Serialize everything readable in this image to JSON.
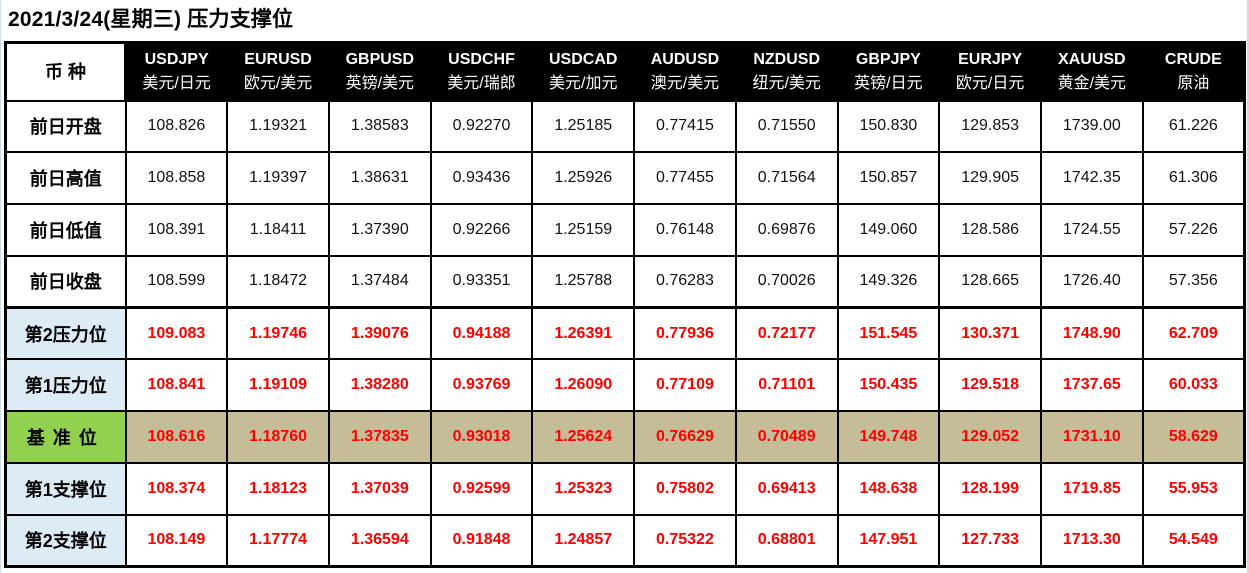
{
  "title": "2021/3/24(星期三) 压力支撑位",
  "corner_label": "币 种",
  "colors": {
    "header_bg": "#000000",
    "header_text": "#ffffff",
    "level_text": "#ff0000",
    "level_label_bg": "#ddebf5",
    "pivot_label_bg": "#92d050",
    "pivot_row_bg": "#c4bd97"
  },
  "columns": [
    {
      "code": "USDJPY",
      "name": "美元/日元"
    },
    {
      "code": "EURUSD",
      "name": "欧元/美元"
    },
    {
      "code": "GBPUSD",
      "name": "英镑/美元"
    },
    {
      "code": "USDCHF",
      "name": "美元/瑞郎"
    },
    {
      "code": "USDCAD",
      "name": "美元/加元"
    },
    {
      "code": "AUDUSD",
      "name": "澳元/美元"
    },
    {
      "code": "NZDUSD",
      "name": "纽元/美元"
    },
    {
      "code": "GBPJPY",
      "name": "英镑/日元"
    },
    {
      "code": "EURJPY",
      "name": "欧元/日元"
    },
    {
      "code": "XAUUSD",
      "name": "黄金/美元"
    },
    {
      "code": "CRUDE",
      "name": "原油"
    }
  ],
  "rows": [
    {
      "label": "前日开盘",
      "type": "hist",
      "values": [
        "108.826",
        "1.19321",
        "1.38583",
        "0.92270",
        "1.25185",
        "0.77415",
        "0.71550",
        "150.830",
        "129.853",
        "1739.00",
        "61.226"
      ]
    },
    {
      "label": "前日高值",
      "type": "hist",
      "values": [
        "108.858",
        "1.19397",
        "1.38631",
        "0.93436",
        "1.25926",
        "0.77455",
        "0.71564",
        "150.857",
        "129.905",
        "1742.35",
        "61.306"
      ]
    },
    {
      "label": "前日低值",
      "type": "hist",
      "values": [
        "108.391",
        "1.18411",
        "1.37390",
        "0.92266",
        "1.25159",
        "0.76148",
        "0.69876",
        "149.060",
        "128.586",
        "1724.55",
        "57.226"
      ]
    },
    {
      "label": "前日收盘",
      "type": "hist",
      "values": [
        "108.599",
        "1.18472",
        "1.37484",
        "0.93351",
        "1.25788",
        "0.76283",
        "0.70026",
        "149.326",
        "128.665",
        "1726.40",
        "57.356"
      ]
    },
    {
      "label": "第2压力位",
      "type": "level",
      "values": [
        "109.083",
        "1.19746",
        "1.39076",
        "0.94188",
        "1.26391",
        "0.77936",
        "0.72177",
        "151.545",
        "130.371",
        "1748.90",
        "62.709"
      ]
    },
    {
      "label": "第1压力位",
      "type": "level",
      "values": [
        "108.841",
        "1.19109",
        "1.38280",
        "0.93769",
        "1.26090",
        "0.77109",
        "0.71101",
        "150.435",
        "129.518",
        "1737.65",
        "60.033"
      ]
    },
    {
      "label": "基准位",
      "type": "pivot",
      "values": [
        "108.616",
        "1.18760",
        "1.37835",
        "0.93018",
        "1.25624",
        "0.76629",
        "0.70489",
        "149.748",
        "129.052",
        "1731.10",
        "58.629"
      ]
    },
    {
      "label": "第1支撑位",
      "type": "level",
      "values": [
        "108.374",
        "1.18123",
        "1.37039",
        "0.92599",
        "1.25323",
        "0.75802",
        "0.69413",
        "148.638",
        "128.199",
        "1719.85",
        "55.953"
      ]
    },
    {
      "label": "第2支撑位",
      "type": "level",
      "values": [
        "108.149",
        "1.17774",
        "1.36594",
        "0.91848",
        "1.24857",
        "0.75322",
        "0.68801",
        "147.951",
        "127.733",
        "1713.30",
        "54.549"
      ]
    }
  ]
}
